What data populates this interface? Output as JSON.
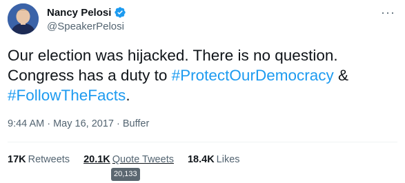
{
  "author": {
    "name": "Nancy Pelosi",
    "handle": "@SpeakerPelosi",
    "verified_icon": "verified-badge-icon"
  },
  "menu": {
    "label": "···"
  },
  "tweet": {
    "line1": "Our election was hijacked. There is no question.",
    "line2_prefix": "Congress has a duty to ",
    "hashtag1": "#ProtectOurDemocracy",
    "line2_suffix": " &",
    "hashtag2": "#FollowTheFacts",
    "line3_suffix": "."
  },
  "meta": {
    "time": "9:44 AM",
    "sep1": " · ",
    "date": "May 16, 2017",
    "sep2": " · ",
    "source": "Buffer"
  },
  "stats": {
    "retweets_count": "17K",
    "retweets_label": "Retweets",
    "quote_count": "20.1K",
    "quote_label": "Quote Tweets",
    "likes_count": "18.4K",
    "likes_label": "Likes"
  },
  "tooltip": {
    "text": "20,133"
  },
  "colors": {
    "accent": "#1d9bf0",
    "text": "#0f1419",
    "muted": "#536471"
  }
}
